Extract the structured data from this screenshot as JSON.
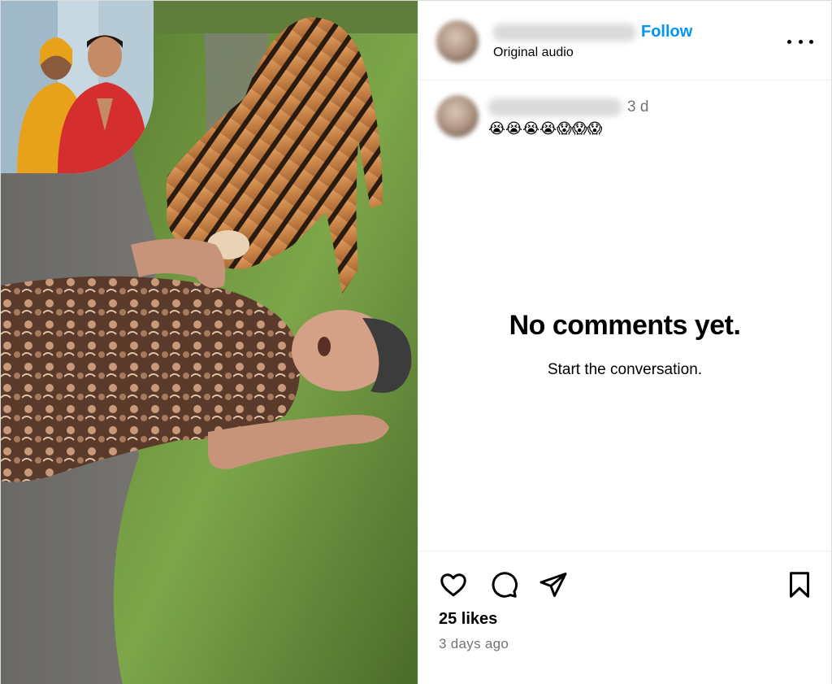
{
  "post": {
    "header": {
      "follow_label": "Follow",
      "follow_separator": "·",
      "audio_label": "Original audio",
      "more_icon": "more-options-icon"
    },
    "comment": {
      "time": "3 d",
      "text": "😭😭😭😭😱😱😱"
    },
    "empty_state": {
      "title": "No comments yet.",
      "subtitle": "Start the conversation."
    },
    "actions": {
      "icons": [
        "heart-icon",
        "comment-icon",
        "share-icon",
        "bookmark-icon"
      ],
      "likes_label": "25 likes",
      "posted_label": "3 days ago"
    }
  },
  "colors": {
    "accent_blue": "#0095f6",
    "muted_gray": "#737373",
    "divider": "#efefef"
  }
}
